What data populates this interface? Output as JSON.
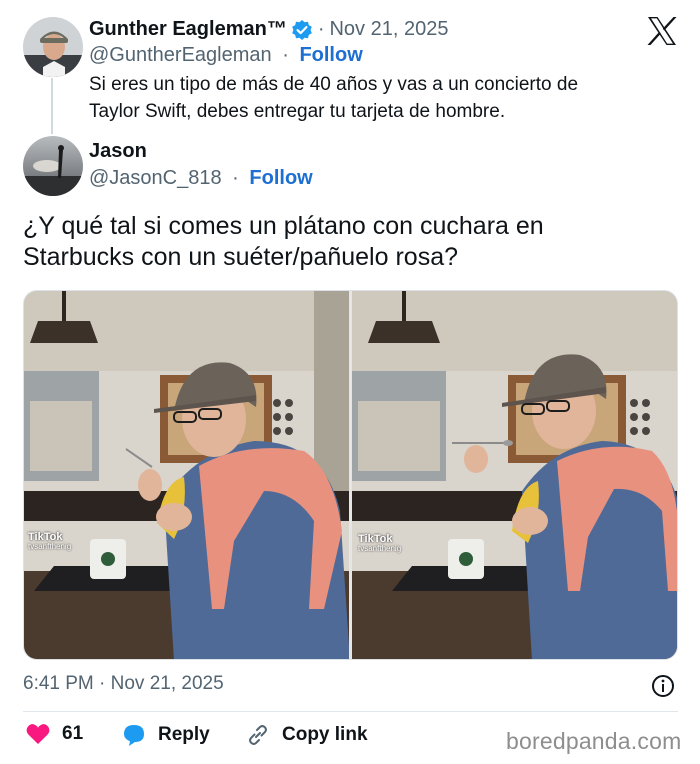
{
  "original_tweet": {
    "display_name": "Gunther Eagleman™",
    "separator": "·",
    "date": "Nov 21, 2025",
    "handle": "@GuntherEagleman",
    "follow_label": "Follow",
    "text_line1": "Si eres un tipo de más de 40 años y vas a un concierto de",
    "text_line2": "Taylor Swift, debes entregar tu tarjeta de hombre."
  },
  "reply_tweet": {
    "display_name": "Jason",
    "handle": "@JasonC_818",
    "follow_label": "Follow",
    "text_line1": "¿Y qué tal si comes un plátano con cuchara en",
    "text_line2": "Starbucks con un suéter/pañuelo rosa?",
    "timestamp": "6:41 PM · Nov 21, 2025"
  },
  "media": {
    "watermark_left": "TikTok",
    "watermark_right": "TikTok",
    "tiktok_user": "tvsanfthenig"
  },
  "actions": {
    "likes_count": "61",
    "reply_label": "Reply",
    "copy_link_label": "Copy link"
  },
  "site_watermark": "boredpanda.com",
  "colors": {
    "verified_blue": "#1d9bf0",
    "link_blue": "#1d6fd1",
    "like_pink": "#f91880",
    "reply_blue": "#1d9bf0"
  },
  "icons": [
    "x-logo-icon",
    "verified-badge-icon",
    "info-icon",
    "heart-icon",
    "reply-bubble-icon",
    "link-icon"
  ]
}
